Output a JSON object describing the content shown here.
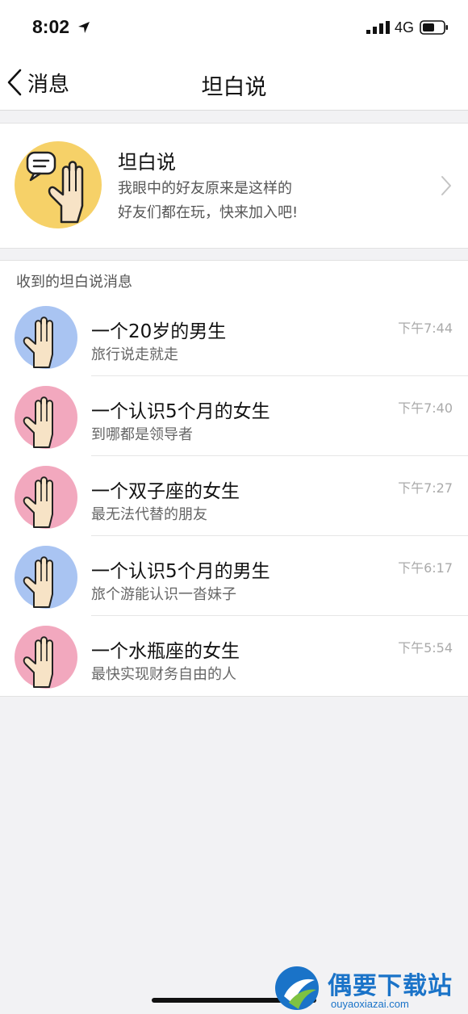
{
  "status_bar": {
    "time": "8:02",
    "network": "4G"
  },
  "nav": {
    "back_label": "消息",
    "title": "坦白说"
  },
  "banner": {
    "title": "坦白说",
    "line1": "我眼中的好友原来是这样的",
    "line2": "好友们都在玩，快来加入吧!"
  },
  "section": {
    "title": "收到的坦白说消息"
  },
  "messages": [
    {
      "name": "一个20岁的男生",
      "preview": "旅行说走就走",
      "time": "下午7:44",
      "avatar_color": "#a9c4f2"
    },
    {
      "name": "一个认识5个月的女生",
      "preview": "到哪都是领导者",
      "time": "下午7:40",
      "avatar_color": "#f2a8be"
    },
    {
      "name": "一个双子座的女生",
      "preview": "最无法代替的朋友",
      "time": "下午7:27",
      "avatar_color": "#f2a8be"
    },
    {
      "name": "一个认识5个月的男生",
      "preview": "旅个游能认识一沓妹子",
      "time": "下午6:17",
      "avatar_color": "#a9c4f2"
    },
    {
      "name": "一个水瓶座的女生",
      "preview": "最快实现财务自由的人",
      "time": "下午5:54",
      "avatar_color": "#f2a8be"
    }
  ],
  "watermark": {
    "title": "偶要下载站",
    "url": "ouyaoxiazai.com"
  },
  "colors": {
    "banner_avatar": "#f6d168",
    "male_avatar": "#a9c4f2",
    "female_avatar": "#f2a8be",
    "watermark": "#1a73c8"
  }
}
